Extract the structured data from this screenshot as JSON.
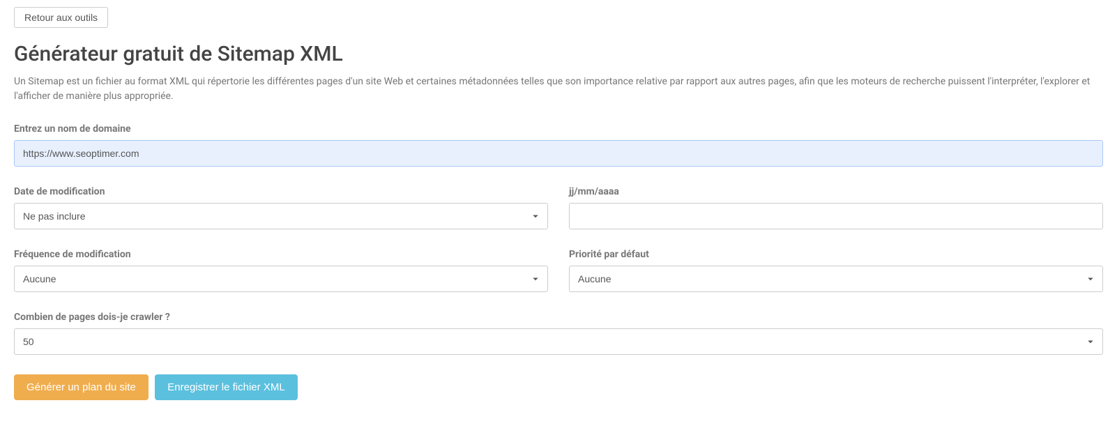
{
  "back_button": "Retour aux outils",
  "title": "Générateur gratuit de Sitemap XML",
  "description": "Un Sitemap est un fichier au format XML qui répertorie les différentes pages d'un site Web et certaines métadonnées telles que son importance relative par rapport aux autres pages, afin que les moteurs de recherche puissent l'interpréter, l'explorer et l'afficher de manière plus appropriée.",
  "domain": {
    "label": "Entrez un nom de domaine",
    "value": "https://www.seoptimer.com"
  },
  "mod_date": {
    "label": "Date de modification",
    "selected": "Ne pas inclure"
  },
  "date_format": {
    "label": "jj/mm/aaaa",
    "value": ""
  },
  "change_freq": {
    "label": "Fréquence de modification",
    "selected": "Aucune"
  },
  "priority": {
    "label": "Priorité par défaut",
    "selected": "Aucune"
  },
  "crawl_pages": {
    "label": "Combien de pages dois-je crawler ?",
    "selected": "50"
  },
  "buttons": {
    "generate": "Générer un plan du site",
    "save": "Enregistrer le fichier XML"
  }
}
